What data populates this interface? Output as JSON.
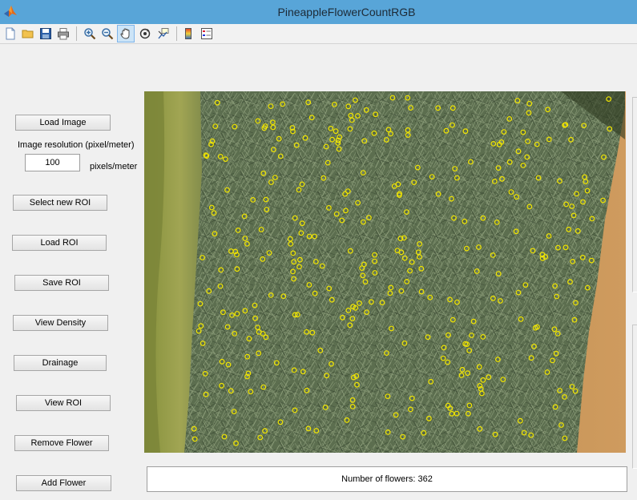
{
  "window": {
    "title": "PineappleFlowerCountRGB",
    "app_icon": "matlab-icon"
  },
  "toolbar": {
    "items": [
      {
        "icon": "new-file-icon"
      },
      {
        "icon": "open-folder-icon"
      },
      {
        "icon": "save-icon"
      },
      {
        "icon": "print-icon"
      },
      {
        "icon": "zoom-in-icon"
      },
      {
        "icon": "zoom-out-icon"
      },
      {
        "icon": "pan-hand-icon",
        "active": true
      },
      {
        "icon": "rotate-3d-icon"
      },
      {
        "icon": "data-cursor-icon"
      },
      {
        "icon": "colorbar-icon"
      },
      {
        "icon": "legend-icon"
      }
    ]
  },
  "controls": {
    "load_image": "Load Image",
    "resolution_label": "Image resolution (pixel/meter)",
    "resolution_value": "100",
    "resolution_unit": "pixels/meter",
    "select_roi": "Select new ROI",
    "load_roi": "Load ROI",
    "save_roi": "Save ROI",
    "view_density": "View Density",
    "drainage": "Drainage",
    "view_roi": "View ROI",
    "remove_flower": "Remove Flower",
    "add_flower": "Add Flower"
  },
  "status": {
    "flower_count_text": "Number of flowers: 362"
  },
  "colors": {
    "title_bar": "#58a5d8",
    "field_green": "#5c6e4f",
    "soil": "#c9955a",
    "marker": "#f2e600"
  }
}
